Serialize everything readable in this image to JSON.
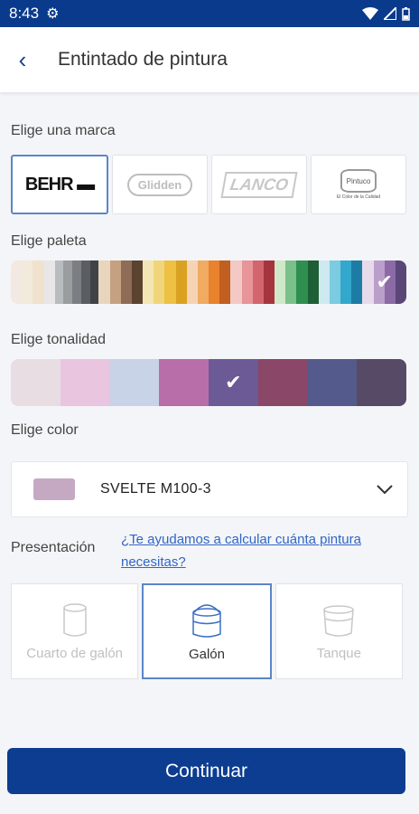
{
  "status": {
    "time": "8:43"
  },
  "header": {
    "title": "Entintado de pintura"
  },
  "labels": {
    "brand": "Elige una marca",
    "palette": "Elige paleta",
    "shade": "Elige tonalidad",
    "color": "Elige color",
    "presentation": "Presentación"
  },
  "brands": [
    {
      "name": "BEHR",
      "selected": true
    },
    {
      "name": "Glidden",
      "selected": false
    },
    {
      "name": "LANCO",
      "selected": false
    },
    {
      "name": "Pintuco",
      "tagline": "El Color de la Calidad",
      "selected": false
    }
  ],
  "palettes": [
    [
      "#f3e8e2",
      "#f2eadb",
      "#f0e2cc",
      "#e8e6e6"
    ],
    [
      "#b9bcbf",
      "#9a9da0",
      "#7b7f83",
      "#5a5e62",
      "#3f4347"
    ],
    [
      "#e8d5bd",
      "#c6a181",
      "#8e6c55",
      "#5b4330"
    ],
    [
      "#f3e6b4",
      "#f1d57a",
      "#eec043",
      "#d9a222"
    ],
    [
      "#f6d3b5",
      "#f1aa61",
      "#e8822c",
      "#c05f1f"
    ],
    [
      "#f3c9c6",
      "#e79599",
      "#d2656d",
      "#a6343f"
    ],
    [
      "#cfe8c8",
      "#79c08a",
      "#2f8f50",
      "#1e5f36"
    ],
    [
      "#cdeaf0",
      "#7ccbe0",
      "#33a8cc",
      "#1d7ca4"
    ],
    [
      "#e7dbeb",
      "#bb9fcb",
      "#8b6aa6",
      "#5a4778"
    ]
  ],
  "selected_palette": 8,
  "shades": [
    "#e8dde3",
    "#e9c5df",
    "#c9d3e8",
    "#b86ea8",
    "#6c5a96",
    "#8a4768",
    "#545b8c",
    "#564a66"
  ],
  "selected_shade": 4,
  "color_select": {
    "value": "SVELTE M100-3",
    "swatch": "#c5a9c3"
  },
  "help_link": "¿Te ayudamos a calcular cuánta pintura necesitas?",
  "sizes": [
    {
      "label": "Cuarto de galón",
      "selected": false
    },
    {
      "label": "Galón",
      "selected": true
    },
    {
      "label": "Tanque",
      "selected": false
    }
  ],
  "cta": "Continuar",
  "colors": {
    "primary": "#0d3d91",
    "selection_border": "#5b86c9",
    "link": "#2f66c6"
  }
}
